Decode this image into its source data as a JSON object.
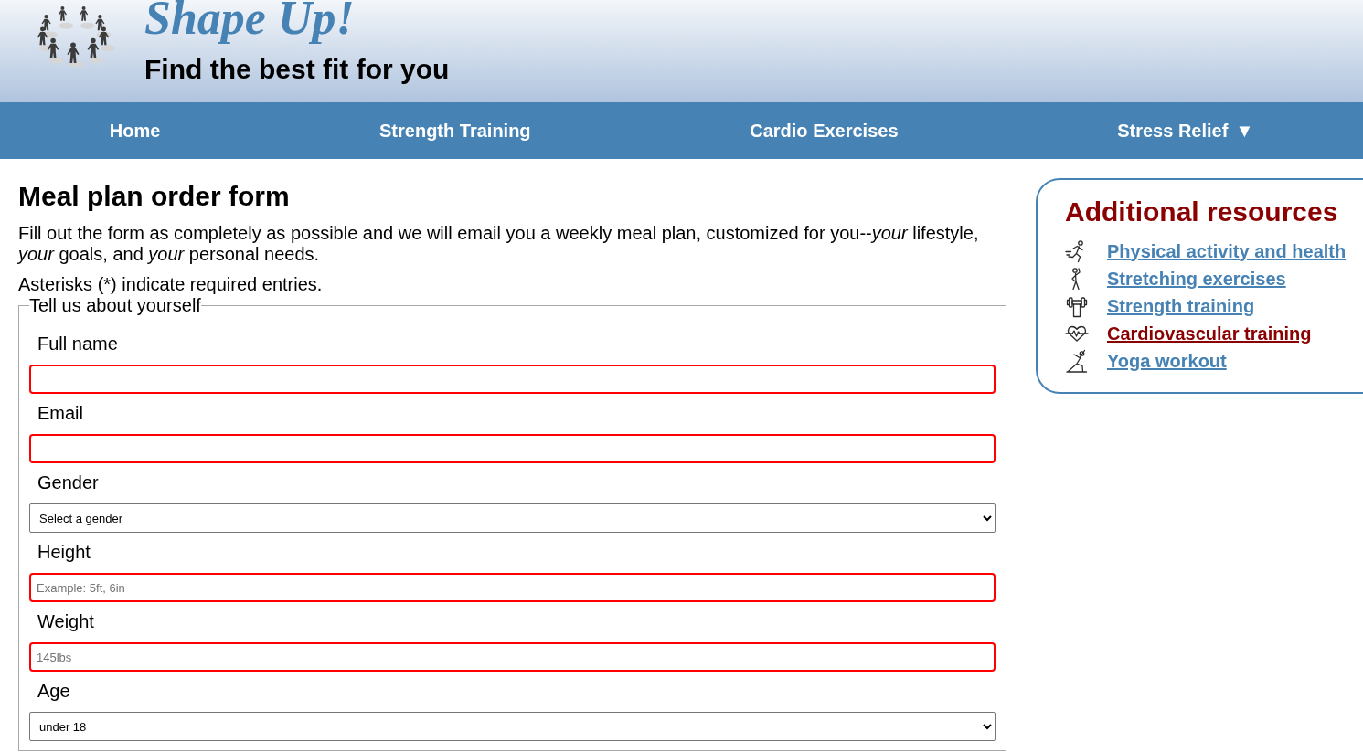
{
  "header": {
    "title": "Shape Up!",
    "tagline": "Find the best fit for you"
  },
  "nav": [
    {
      "label": "Home"
    },
    {
      "label": "Strength Training"
    },
    {
      "label": "Cardio Exercises"
    },
    {
      "label": "Stress Relief",
      "caret": "▼"
    }
  ],
  "form": {
    "heading": "Meal plan order form",
    "intro": "Fill out the form as completely as possible and we will email you a weekly meal plan, customized for you--*your* lifestyle, *your* goals, and *your* personal needs.",
    "note": "Asterisks (*) indicate required entries.",
    "fieldset": {
      "legend": "Tell us about yourself",
      "fields": [
        {
          "label": "Full name",
          "kind": "text",
          "invalid": true
        },
        {
          "label": "Email",
          "kind": "text",
          "invalid": true
        },
        {
          "label": "Gender",
          "kind": "select",
          "invalid": false,
          "value": "Select a gender"
        },
        {
          "label": "Height",
          "kind": "text",
          "invalid": true,
          "placeholder": "Example: 5ft, 6in"
        },
        {
          "label": "Weight",
          "kind": "text",
          "invalid": true,
          "placeholder": "145lbs"
        },
        {
          "label": "Age",
          "kind": "select",
          "invalid": false,
          "value": "under 18"
        }
      ]
    }
  },
  "resources": {
    "heading": "Additional resources",
    "links": [
      {
        "label": "Physical activity and health",
        "visited": false
      },
      {
        "label": "Stretching exercises",
        "visited": false
      },
      {
        "label": "Strength training",
        "visited": false
      },
      {
        "label": "Cardiovascular training",
        "visited": true
      },
      {
        "label": "Yoga workout",
        "visited": false
      }
    ]
  }
}
